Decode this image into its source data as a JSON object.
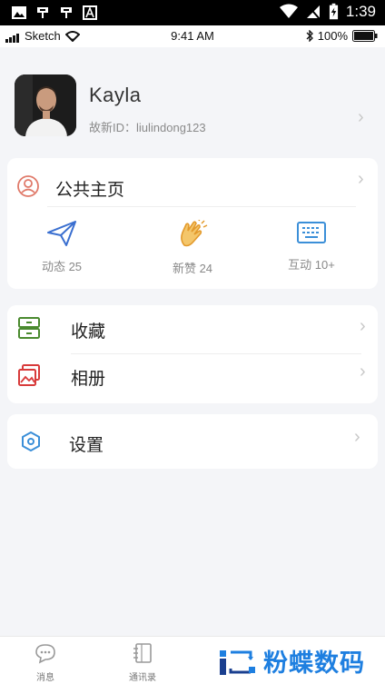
{
  "system_bar": {
    "time": "1:39"
  },
  "ios_bar": {
    "carrier": "Sketch",
    "time": "9:41 AM",
    "battery": "100%"
  },
  "profile": {
    "name": "Kayla",
    "id_label": "故新ID：liulindong123"
  },
  "public_page": {
    "label": "公共主页",
    "stats": [
      {
        "icon": "paper-plane-icon",
        "label": "动态 25"
      },
      {
        "icon": "clapping-hands-icon",
        "label": "新赞 24"
      },
      {
        "icon": "keyboard-icon",
        "label": "互动  10+"
      }
    ]
  },
  "menu": {
    "favorites": "收藏",
    "album": "相册",
    "settings": "设置"
  },
  "tabbar": {
    "messages": "消息",
    "contacts": "通讯录"
  },
  "watermark": {
    "text": "粉蝶数码"
  },
  "colors": {
    "accent": "#1e7fe0",
    "bg": "#f4f5f8",
    "green": "#4a8a2f",
    "red": "#d83b3b",
    "blue_icon": "#3b8fd8",
    "orange": "#e8a33a"
  }
}
